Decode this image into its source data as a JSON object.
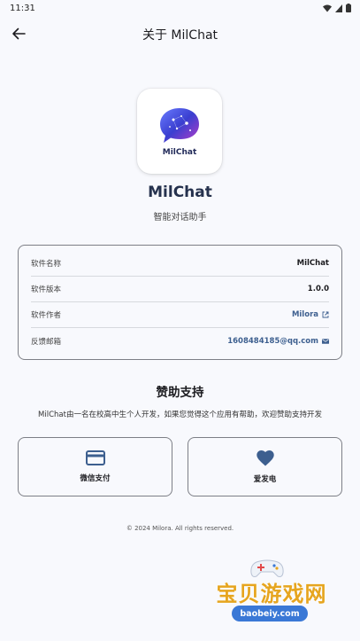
{
  "status_bar": {
    "time": "11:31"
  },
  "app_bar": {
    "title": "关于 MilChat"
  },
  "app": {
    "logo_text": "MilChat",
    "name": "MilChat",
    "subtitle": "智能对话助手"
  },
  "info": {
    "rows": [
      {
        "label": "软件名称",
        "value": "MilChat"
      },
      {
        "label": "软件版本",
        "value": "1.0.0"
      },
      {
        "label": "软件作者",
        "value": "Milora"
      },
      {
        "label": "反馈邮箱",
        "value": "1608484185@qq.com"
      }
    ]
  },
  "support": {
    "title": "赞助支持",
    "description": "MilChat由一名在校高中生个人开发，如果您觉得这个应用有帮助，欢迎赞助支持开发",
    "buttons": [
      {
        "label": "微信支付",
        "icon": "credit-card-icon"
      },
      {
        "label": "爱发电",
        "icon": "heart-icon"
      }
    ]
  },
  "footer": {
    "text": "© 2024 Milora. All rights reserved."
  },
  "watermark": {
    "text": "宝贝游戏网",
    "url": "baobeiy.com"
  },
  "colors": {
    "background": "#f8f9fd",
    "accent": "#3d5f8f",
    "title": "#26324e",
    "border": "#7d7f86"
  }
}
